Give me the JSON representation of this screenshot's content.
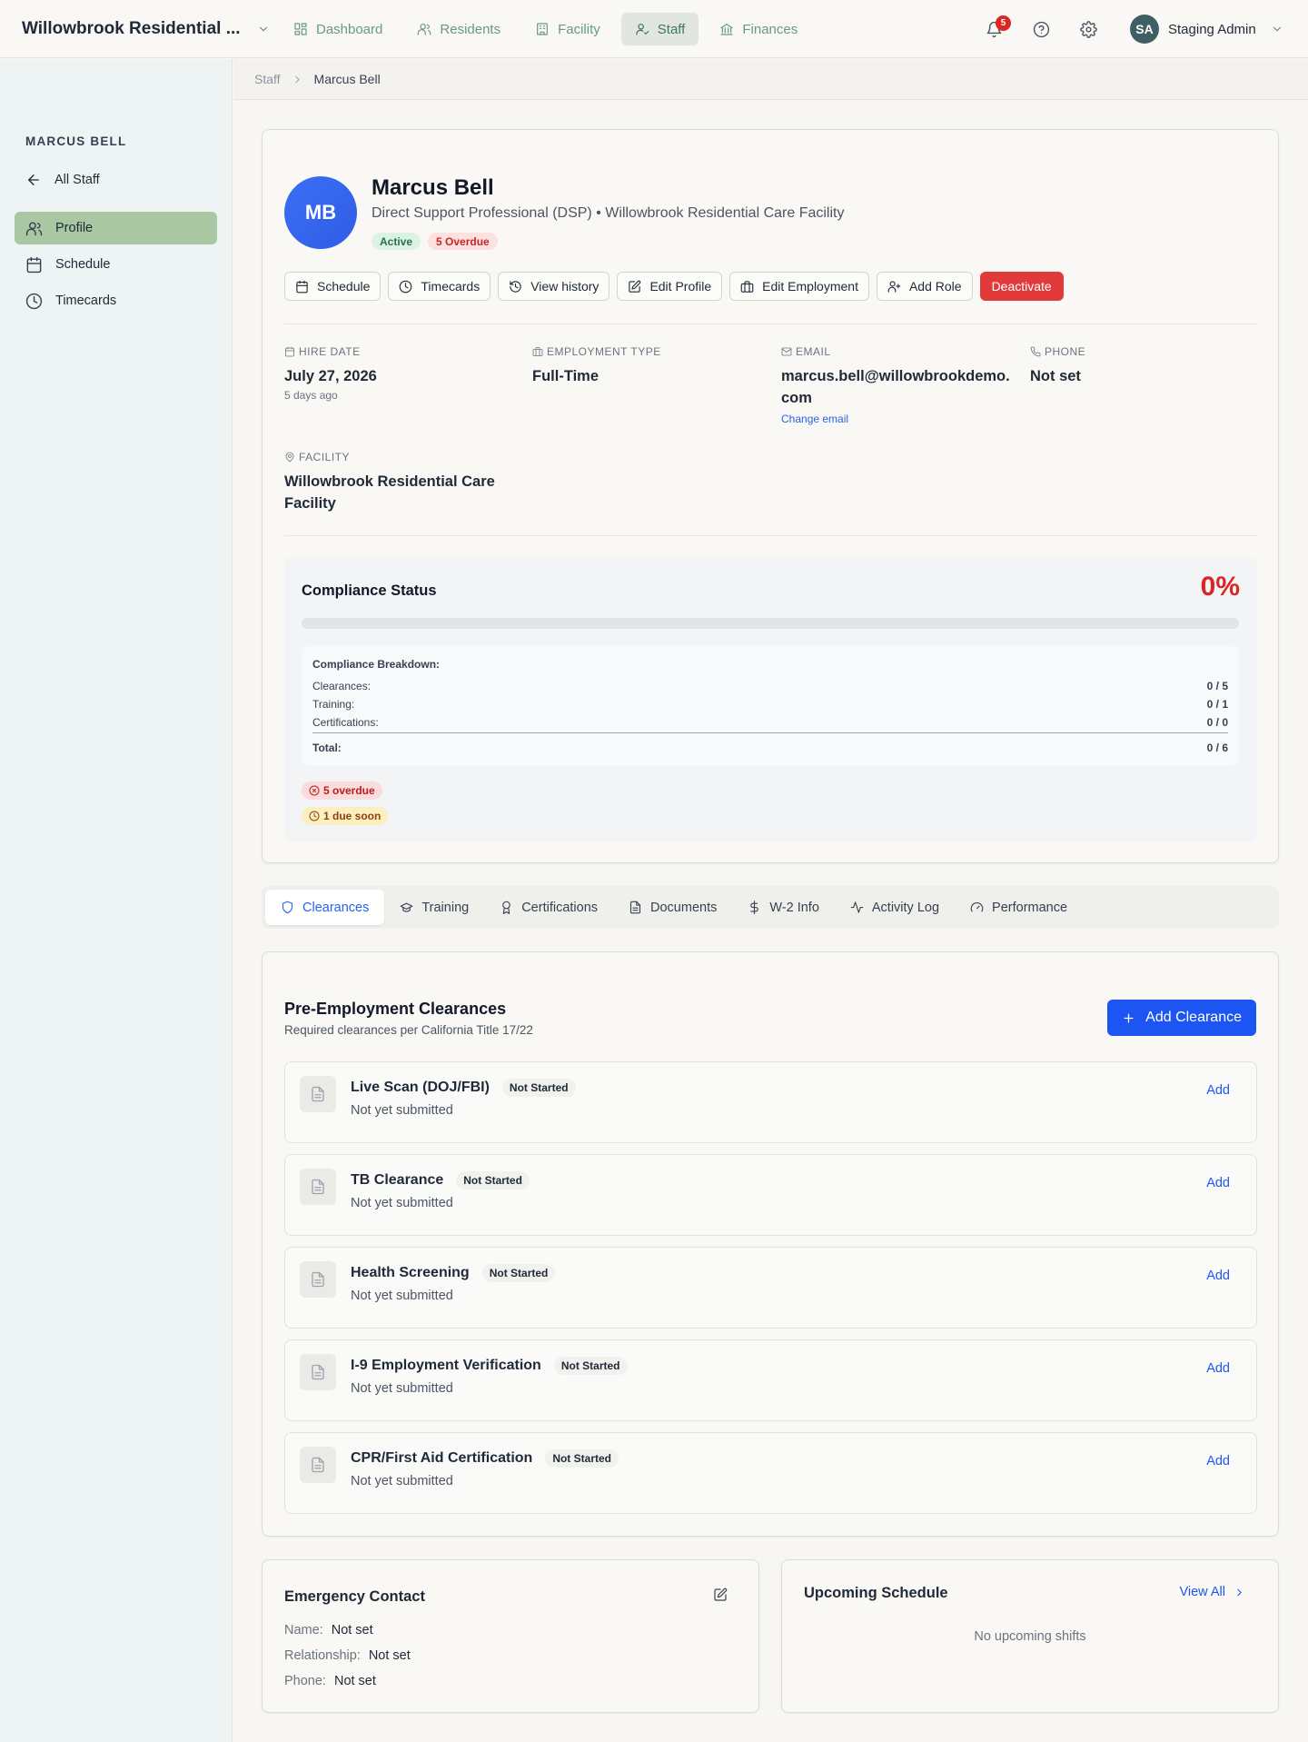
{
  "app": {
    "facility_selector": "Willowbrook Residential ...",
    "nav": [
      {
        "label": "Dashboard",
        "icon": "dashboard-icon"
      },
      {
        "label": "Residents",
        "icon": "users-icon"
      },
      {
        "label": "Facility",
        "icon": "building-icon"
      },
      {
        "label": "Staff",
        "icon": "staff-icon",
        "active": true
      },
      {
        "label": "Finances",
        "icon": "bank-icon"
      }
    ],
    "notifications_count": "5",
    "user": {
      "initials": "SA",
      "name": "Staging Admin"
    }
  },
  "sidebar": {
    "heading": "MARCUS BELL",
    "back_label": "All Staff",
    "items": [
      {
        "label": "Profile",
        "icon": "user-icon",
        "active": true
      },
      {
        "label": "Schedule",
        "icon": "calendar-icon"
      },
      {
        "label": "Timecards",
        "icon": "clock-icon"
      }
    ]
  },
  "breadcrumb": {
    "parent": "Staff",
    "current": "Marcus Bell"
  },
  "profile": {
    "initials": "MB",
    "name": "Marcus Bell",
    "role": "Direct Support Professional (DSP)",
    "separator": "•",
    "facility": "Willowbrook Residential Care Facility",
    "badges": {
      "status": "Active",
      "overdue": "5 Overdue"
    },
    "actions": {
      "schedule": "Schedule",
      "timecards": "Timecards",
      "history": "View history",
      "edit_profile": "Edit Profile",
      "edit_employment": "Edit Employment",
      "add_role": "Add Role",
      "deactivate": "Deactivate"
    },
    "info": {
      "hire_date_label": "HIRE DATE",
      "hire_date": "July 27, 2026",
      "hire_date_relative": "5 days ago",
      "employment_type_label": "EMPLOYMENT TYPE",
      "employment_type": "Full-Time",
      "email_label": "EMAIL",
      "email_line1": "marcus.bell@willowbrookdemo.",
      "email_line2": "com",
      "change_email": "Change email",
      "phone_label": "PHONE",
      "phone": "Not set",
      "facility_label": "FACILITY",
      "facility_line1": "Willowbrook Residential Care",
      "facility_line2": "Facility"
    }
  },
  "compliance": {
    "title": "Compliance Status",
    "percent_label": "0%",
    "percent": 0,
    "breakdown_title": "Compliance Breakdown:",
    "rows": [
      {
        "label": "Clearances:",
        "value": "0 / 5"
      },
      {
        "label": "Training:",
        "value": "0 / 1"
      },
      {
        "label": "Certifications:",
        "value": "0 / 0"
      }
    ],
    "total": {
      "label": "Total:",
      "value": "0 / 6"
    },
    "overdue": "5 overdue",
    "due_soon": "1 due soon",
    "colors": {
      "danger": "#dc2626"
    }
  },
  "tabs": [
    {
      "label": "Clearances",
      "icon": "shield-icon",
      "active": true
    },
    {
      "label": "Training",
      "icon": "graduation-cap-icon"
    },
    {
      "label": "Certifications",
      "icon": "award-icon"
    },
    {
      "label": "Documents",
      "icon": "document-icon"
    },
    {
      "label": "W-2 Info",
      "icon": "dollar-icon"
    },
    {
      "label": "Activity Log",
      "icon": "activity-icon"
    },
    {
      "label": "Performance",
      "icon": "gauge-icon"
    }
  ],
  "clearances": {
    "title": "Pre-Employment Clearances",
    "subtitle": "Required clearances per California Title 17/22",
    "add_button": "Add Clearance",
    "items": [
      {
        "name": "Live Scan (DOJ/FBI)",
        "status": "Not Started",
        "desc": "Not yet submitted",
        "action": "Add"
      },
      {
        "name": "TB Clearance",
        "status": "Not Started",
        "desc": "Not yet submitted",
        "action": "Add"
      },
      {
        "name": "Health Screening",
        "status": "Not Started",
        "desc": "Not yet submitted",
        "action": "Add"
      },
      {
        "name": "I-9 Employment Verification",
        "status": "Not Started",
        "desc": "Not yet submitted",
        "action": "Add"
      },
      {
        "name": "CPR/First Aid Certification",
        "status": "Not Started",
        "desc": "Not yet submitted",
        "action": "Add"
      }
    ]
  },
  "emergency_contact": {
    "title": "Emergency Contact",
    "rows": [
      {
        "label": "Name:",
        "value": "Not set"
      },
      {
        "label": "Relationship:",
        "value": "Not set"
      },
      {
        "label": "Phone:",
        "value": "Not set"
      }
    ]
  },
  "upcoming_schedule": {
    "title": "Upcoming Schedule",
    "view_all": "View All",
    "empty": "No upcoming shifts"
  }
}
